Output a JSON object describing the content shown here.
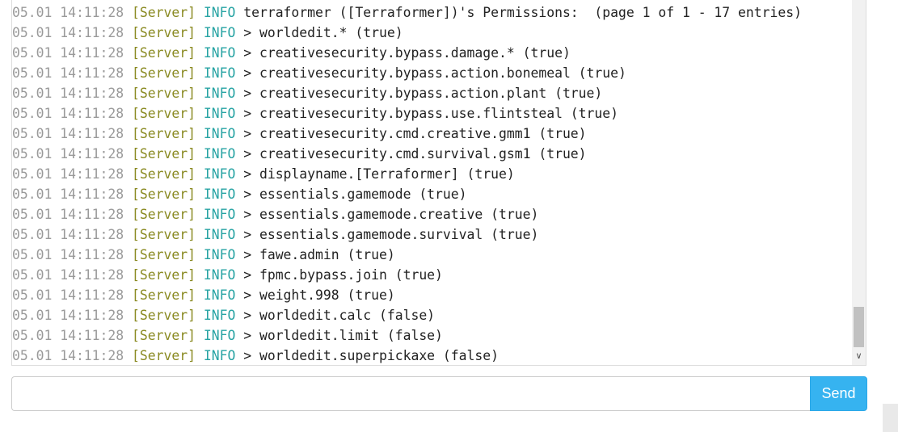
{
  "console": {
    "lines": [
      {
        "ts": "05.01 14:11:28",
        "src": "[Server]",
        "lvl": "INFO",
        "msg": "terraformer ([Terraformer])'s Permissions:  (page 1 of 1 - 17 entries)"
      },
      {
        "ts": "05.01 14:11:28",
        "src": "[Server]",
        "lvl": "INFO",
        "msg": "> worldedit.* (true)"
      },
      {
        "ts": "05.01 14:11:28",
        "src": "[Server]",
        "lvl": "INFO",
        "msg": "> creativesecurity.bypass.damage.* (true)"
      },
      {
        "ts": "05.01 14:11:28",
        "src": "[Server]",
        "lvl": "INFO",
        "msg": "> creativesecurity.bypass.action.bonemeal (true)"
      },
      {
        "ts": "05.01 14:11:28",
        "src": "[Server]",
        "lvl": "INFO",
        "msg": "> creativesecurity.bypass.action.plant (true)"
      },
      {
        "ts": "05.01 14:11:28",
        "src": "[Server]",
        "lvl": "INFO",
        "msg": "> creativesecurity.bypass.use.flintsteal (true)"
      },
      {
        "ts": "05.01 14:11:28",
        "src": "[Server]",
        "lvl": "INFO",
        "msg": "> creativesecurity.cmd.creative.gmm1 (true)"
      },
      {
        "ts": "05.01 14:11:28",
        "src": "[Server]",
        "lvl": "INFO",
        "msg": "> creativesecurity.cmd.survival.gsm1 (true)"
      },
      {
        "ts": "05.01 14:11:28",
        "src": "[Server]",
        "lvl": "INFO",
        "msg": "> displayname.[Terraformer] (true)"
      },
      {
        "ts": "05.01 14:11:28",
        "src": "[Server]",
        "lvl": "INFO",
        "msg": "> essentials.gamemode (true)"
      },
      {
        "ts": "05.01 14:11:28",
        "src": "[Server]",
        "lvl": "INFO",
        "msg": "> essentials.gamemode.creative (true)"
      },
      {
        "ts": "05.01 14:11:28",
        "src": "[Server]",
        "lvl": "INFO",
        "msg": "> essentials.gamemode.survival (true)"
      },
      {
        "ts": "05.01 14:11:28",
        "src": "[Server]",
        "lvl": "INFO",
        "msg": "> fawe.admin (true)"
      },
      {
        "ts": "05.01 14:11:28",
        "src": "[Server]",
        "lvl": "INFO",
        "msg": "> fpmc.bypass.join (true)"
      },
      {
        "ts": "05.01 14:11:28",
        "src": "[Server]",
        "lvl": "INFO",
        "msg": "> weight.998 (true)"
      },
      {
        "ts": "05.01 14:11:28",
        "src": "[Server]",
        "lvl": "INFO",
        "msg": "> worldedit.calc (false)"
      },
      {
        "ts": "05.01 14:11:28",
        "src": "[Server]",
        "lvl": "INFO",
        "msg": "> worldedit.limit (false)"
      },
      {
        "ts": "05.01 14:11:28",
        "src": "[Server]",
        "lvl": "INFO",
        "msg": "> worldedit.superpickaxe (false)"
      }
    ],
    "scroll_arrow_icon": "chevron-down-icon",
    "colors": {
      "timestamp": "#9a9a9a",
      "source": "#8a8a22",
      "level": "#27a3a3",
      "message": "#222222"
    }
  },
  "command": {
    "value": "",
    "placeholder": "",
    "send_label": "Send",
    "accent": "#36b3f0"
  }
}
